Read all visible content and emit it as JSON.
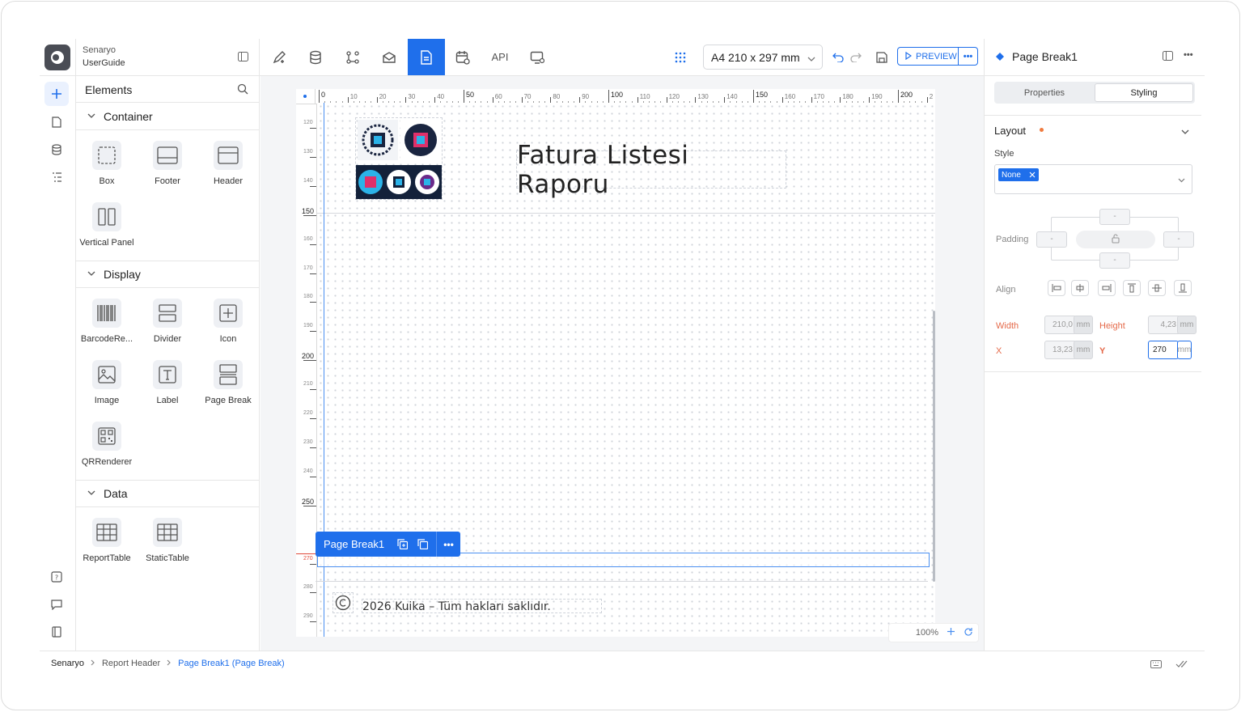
{
  "app": {
    "project": "Senaryo",
    "guide": "UserGuide"
  },
  "elements_panel": {
    "title": "Elements",
    "sections": [
      {
        "title": "Container",
        "items": [
          "Box",
          "Footer",
          "Header",
          "Vertical Panel"
        ]
      },
      {
        "title": "Display",
        "items": [
          "BarcodeRe...",
          "Divider",
          "Icon",
          "Image",
          "Label",
          "Page Break",
          "QRRenderer"
        ]
      },
      {
        "title": "Data",
        "items": [
          "ReportTable",
          "StaticTable"
        ]
      }
    ]
  },
  "toolbar": {
    "api_label": "API",
    "page_size": "A4 210 x 297 mm",
    "preview_label": "PREVIEW"
  },
  "canvas": {
    "report_title": "Fatura Listesi Raporu",
    "footer_text": "2026 Kuika – Tüm hakları saklıdır.",
    "selected_label": "Page Break1",
    "zoom": "100%",
    "ruler_h": [
      "0",
      "10",
      "20",
      "30",
      "40",
      "50",
      "60",
      "70",
      "80",
      "90",
      "100",
      "110",
      "120",
      "130",
      "140",
      "150",
      "160",
      "170",
      "180",
      "190",
      "200",
      "2"
    ],
    "ruler_v": [
      "120",
      "130",
      "140",
      "150",
      "160",
      "170",
      "180",
      "190",
      "200",
      "210",
      "220",
      "230",
      "240",
      "250",
      "270",
      "280",
      "290"
    ]
  },
  "props_panel": {
    "title": "Page Break1",
    "tabs": [
      "Properties",
      "Styling"
    ],
    "active_tab": "Styling",
    "layout_label": "Layout",
    "style_label": "Style",
    "style_tag": "None",
    "padding_label": "Padding",
    "padding_values": {
      "top": "-",
      "left": "-",
      "right": "-",
      "bottom": "-"
    },
    "align_label": "Align",
    "width_label": "Width",
    "width_value": "210,0",
    "width_unit": "mm",
    "height_label": "Height",
    "height_value": "4,23",
    "height_unit": "mm",
    "x_label": "X",
    "x_value": "13,23",
    "x_unit": "mm",
    "y_label": "Y",
    "y_value": "270",
    "y_unit": "mm"
  },
  "breadcrumb": [
    "Senaryo",
    "Report Header",
    "Page Break1 (Page Break)"
  ],
  "colors": {
    "accent": "#1f6feb",
    "orange": "#f07b3f"
  }
}
